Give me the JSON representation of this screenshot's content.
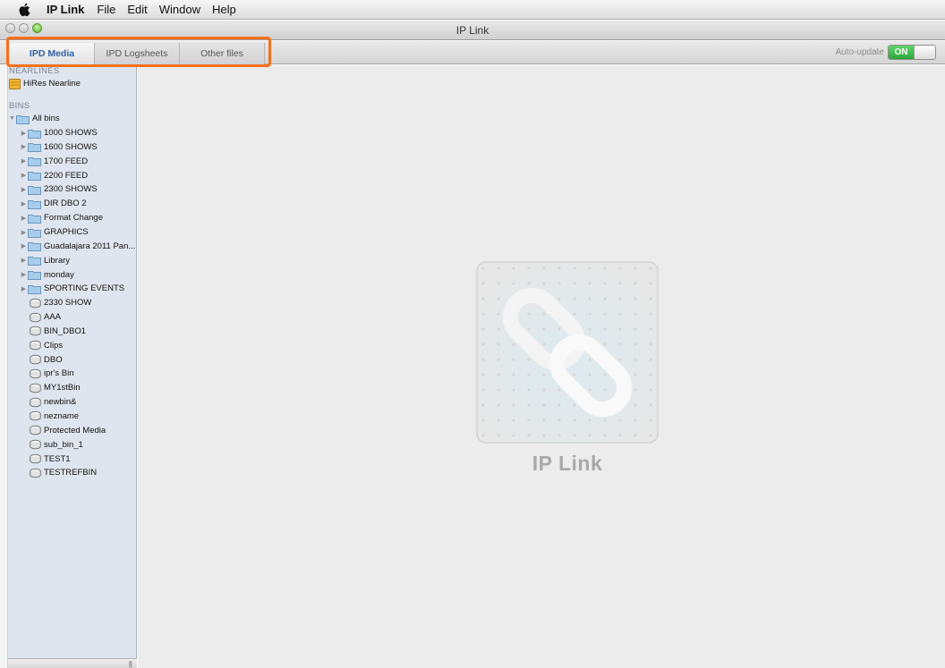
{
  "menubar": {
    "app": "IP Link",
    "items": [
      "File",
      "Edit",
      "Window",
      "Help"
    ]
  },
  "window": {
    "title": "IP Link"
  },
  "tabs": [
    {
      "label": "IPD Media",
      "active": true
    },
    {
      "label": "IPD Logsheets",
      "active": false
    },
    {
      "label": "Other files",
      "active": false
    }
  ],
  "autoupdate": {
    "label": "Auto-update",
    "state": "ON"
  },
  "sidebar": {
    "nearlines_header": "NEARLINES",
    "nearlines": [
      {
        "label": "HiRes Nearline",
        "icon": "nearline-icon"
      }
    ],
    "bins_header": "BINS",
    "all_bins": "All bins",
    "folders": [
      "1000 SHOWS",
      "1600 SHOWS",
      "1700 FEED",
      "2200 FEED",
      "2300 SHOWS",
      "DIR DBO 2",
      "Format Change",
      "GRAPHICS",
      "Guadalajara 2011 Pan...",
      "Library",
      "monday",
      "SPORTING EVENTS"
    ],
    "bins": [
      "2330 SHOW",
      "AAA",
      "BIN_DBO1",
      "Clips",
      "DBO",
      "ipr's Bin",
      "MY1stBin",
      "newbin&",
      "nezname",
      "Protected Media",
      "sub_bin_1",
      "TEST1",
      "TESTREFBIN"
    ]
  },
  "main": {
    "app_name": "IP Link",
    "logo_icon": "chain-link-icon"
  },
  "colors": {
    "highlight": "#f5701c",
    "active_tab": "#2f5fa5",
    "switch_on": "#2ca53a",
    "sidebar_bg": "#dfe5ee",
    "main_bg": "#ececec"
  }
}
